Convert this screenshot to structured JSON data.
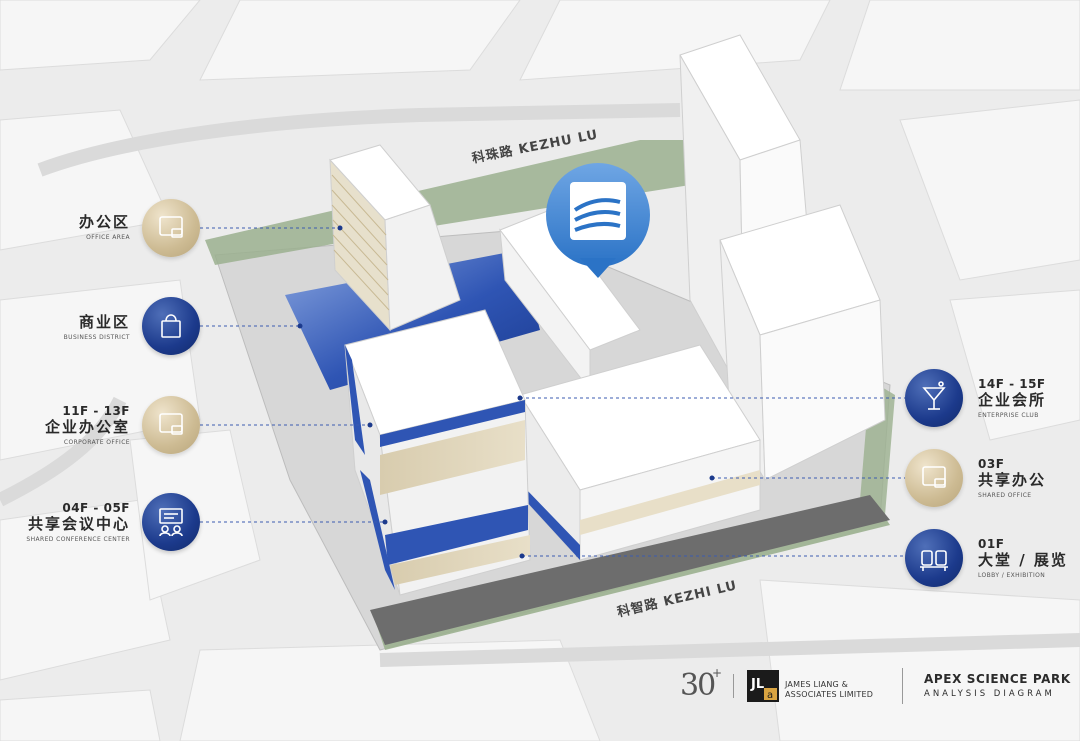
{
  "roads": {
    "north": "科珠路 KEZHU LU",
    "south": "科智路 KEZHI LU"
  },
  "callouts_left": [
    {
      "floor": "",
      "cn": "办公区",
      "en": "OFFICE AREA",
      "style": "gold",
      "icon": "office-screen-icon"
    },
    {
      "floor": "",
      "cn": "商业区",
      "en": "BUSINESS DISTRICT",
      "style": "blue",
      "icon": "shopping-bag-icon"
    },
    {
      "floor": "11F - 13F",
      "cn": "企业办公室",
      "en": "CORPORATE OFFICE",
      "style": "gold",
      "icon": "office-screen-icon"
    },
    {
      "floor": "04F - 05F",
      "cn": "共享会议中心",
      "en": "SHARED CONFERENCE CENTER",
      "style": "blue",
      "icon": "conference-icon"
    }
  ],
  "callouts_right": [
    {
      "floor": "14F - 15F",
      "cn": "企业会所",
      "en": "ENTERPRISE CLUB",
      "style": "blue",
      "icon": "cocktail-icon"
    },
    {
      "floor": "03F",
      "cn": "共享办公",
      "en": "SHARED OFFICE",
      "style": "gold",
      "icon": "office-screen-icon"
    },
    {
      "floor": "01F",
      "cn": "大堂 / 展览",
      "en": "LOBBY / EXHIBITION",
      "style": "blue",
      "icon": "lobby-seats-icon"
    }
  ],
  "footer": {
    "years": "30",
    "years_plus": "+",
    "firm_line1": "JAMES LIANG &",
    "firm_line2": "ASSOCIATES LIMITED",
    "firm_logo_text": "JL a",
    "project_title": "APEX SCIENCE PARK",
    "project_subtitle": "ANALYSIS DIAGRAM"
  },
  "colors": {
    "accent_blue": "#1c3a8c",
    "accent_gold": "#cdbb93",
    "background": "#ececec",
    "green_belt": "#9bb08f"
  }
}
